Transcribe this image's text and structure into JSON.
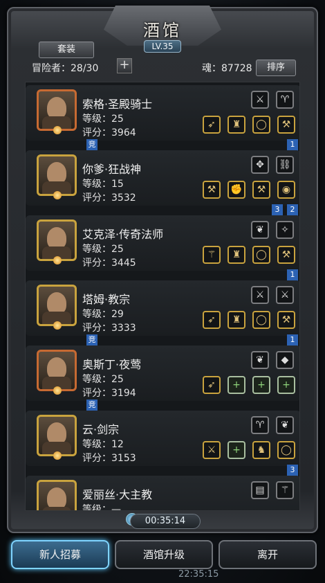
{
  "header": {
    "title": "酒馆",
    "level": "LV.35"
  },
  "toolbar": {
    "equip_label": "套装",
    "sort_label": "排序",
    "adventurers_label": "冒险者：28/30",
    "souls_label": "魂：87728"
  },
  "heroes": [
    {
      "name": "索格·圣殿骑士",
      "level": "等级：25",
      "score": "评分：3964",
      "flags": [
        "竞",
        "1"
      ],
      "top_slots": [
        "sword",
        "horn"
      ],
      "bottom_slots": [
        "spear",
        "robe",
        "ring",
        "claw"
      ]
    },
    {
      "name": "你爹·狂战神",
      "level": "等级：15",
      "score": "评分：3532",
      "flags": [
        "3",
        "2"
      ],
      "top_slots": [
        "emblem",
        "chain"
      ],
      "bottom_slots": [
        "axe",
        "gauntlet",
        "claw",
        "bracelet"
      ]
    },
    {
      "name": "艾克泽·传奇法师",
      "level": "等级：25",
      "score": "评分：3445",
      "flags": [
        "1"
      ],
      "top_slots": [
        "wing",
        "crystal"
      ],
      "bottom_slots": [
        "staff",
        "robe",
        "ring",
        "claw"
      ]
    },
    {
      "name": "塔姆·教宗",
      "level": "等级：29",
      "score": "评分：3333",
      "flags": [
        "竞",
        "1"
      ],
      "top_slots": [
        "sword",
        "sword"
      ],
      "bottom_slots": [
        "spear",
        "robe",
        "ring",
        "claw"
      ]
    },
    {
      "name": "奥斯丁·夜莺",
      "level": "等级：25",
      "score": "评分：3194",
      "flags": [
        "竞"
      ],
      "top_slots": [
        "wing",
        "gem"
      ],
      "bottom_slots": [
        "spear",
        "plus",
        "plus",
        "plus"
      ]
    },
    {
      "name": "云·剑宗",
      "level": "等级：12",
      "score": "评分：3153",
      "flags": [
        "3"
      ],
      "top_slots": [
        "horn",
        "wing"
      ],
      "bottom_slots": [
        "sword",
        "plus",
        "boot",
        "ring"
      ]
    },
    {
      "name": "爱丽丝·大主教",
      "level": "等级：—",
      "score": "",
      "flags": [],
      "top_slots": [
        "book",
        "staff"
      ],
      "bottom_slots": []
    }
  ],
  "bottom": {
    "timer": "00:35:14",
    "recruit_label": "新人招募",
    "upgrade_label": "酒馆升级",
    "leave_label": "离开",
    "clock": "22:35:15"
  },
  "colors": {
    "frame_gold": "#c9a33e",
    "active_button": "#7fd4ff",
    "flag_blue": "#2c62b3"
  }
}
